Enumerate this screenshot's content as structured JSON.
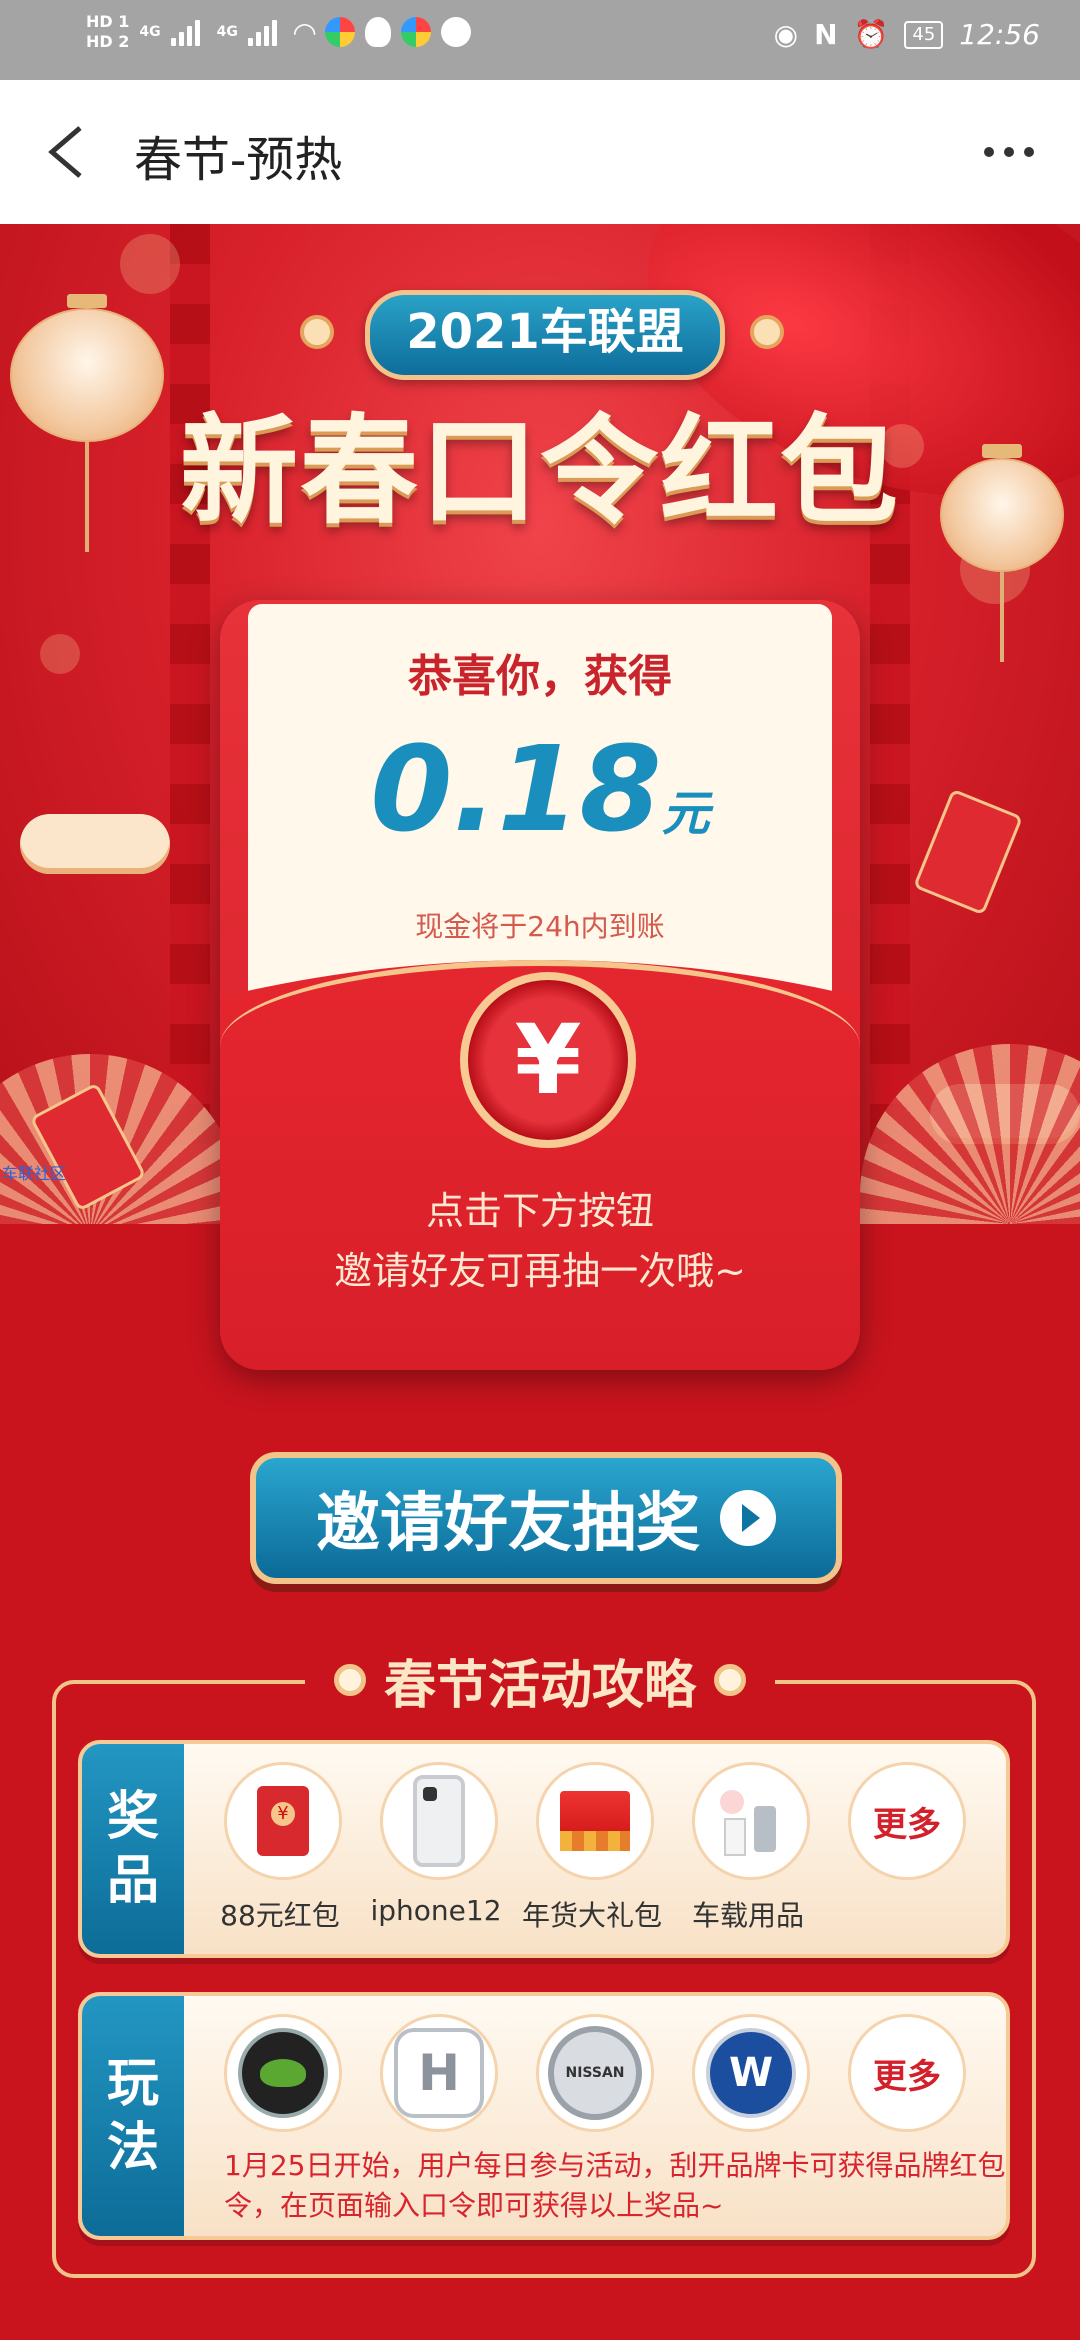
{
  "status_bar": {
    "left_indicators": [
      "HD 1",
      "HD 2"
    ],
    "network_labels": [
      "4G",
      "4G"
    ],
    "battery": "45",
    "time": "12:56"
  },
  "nav": {
    "title": "春节-预热"
  },
  "hero": {
    "badge": "2021车联盟",
    "headline": "新春口令红包"
  },
  "envelope": {
    "congrats": "恭喜你，获得",
    "amount": "0.18",
    "unit": "元",
    "cash_note": "现金将于24h内到账",
    "seal": "¥",
    "cta_line1": "点击下方按钮",
    "cta_line2": "邀请好友可再抽一次哦~"
  },
  "watermark": "车联社区",
  "invite_button": "邀请好友抽奖",
  "strategy": {
    "title": "春节活动攻略",
    "prizes": {
      "tag": [
        "奖",
        "品"
      ],
      "items": [
        {
          "label": "88元红包",
          "icon": "red-packet-icon"
        },
        {
          "label": "iphone12",
          "icon": "iphone-icon"
        },
        {
          "label": "年货大礼包",
          "icon": "gift-box-icon"
        },
        {
          "label": "车载用品",
          "icon": "car-accessory-icon"
        }
      ],
      "more": "更多"
    },
    "rules": {
      "tag": [
        "玩",
        "法"
      ],
      "brands": [
        "skoda-logo-icon",
        "honda-logo-icon",
        "nissan-logo-icon",
        "vw-logo-icon"
      ],
      "brand_text": {
        "honda": "H",
        "nissan": "NISSAN",
        "vw": "W"
      },
      "more": "更多",
      "text": "1月25日开始，用户每日参与活动，刮开品牌卡可获得品牌红包口令，在页面输入口令即可获得以上奖品~"
    }
  },
  "colors": {
    "primary_red": "#c9141e",
    "accent_blue": "#1a8fbd",
    "gold": "#f2c48a"
  }
}
